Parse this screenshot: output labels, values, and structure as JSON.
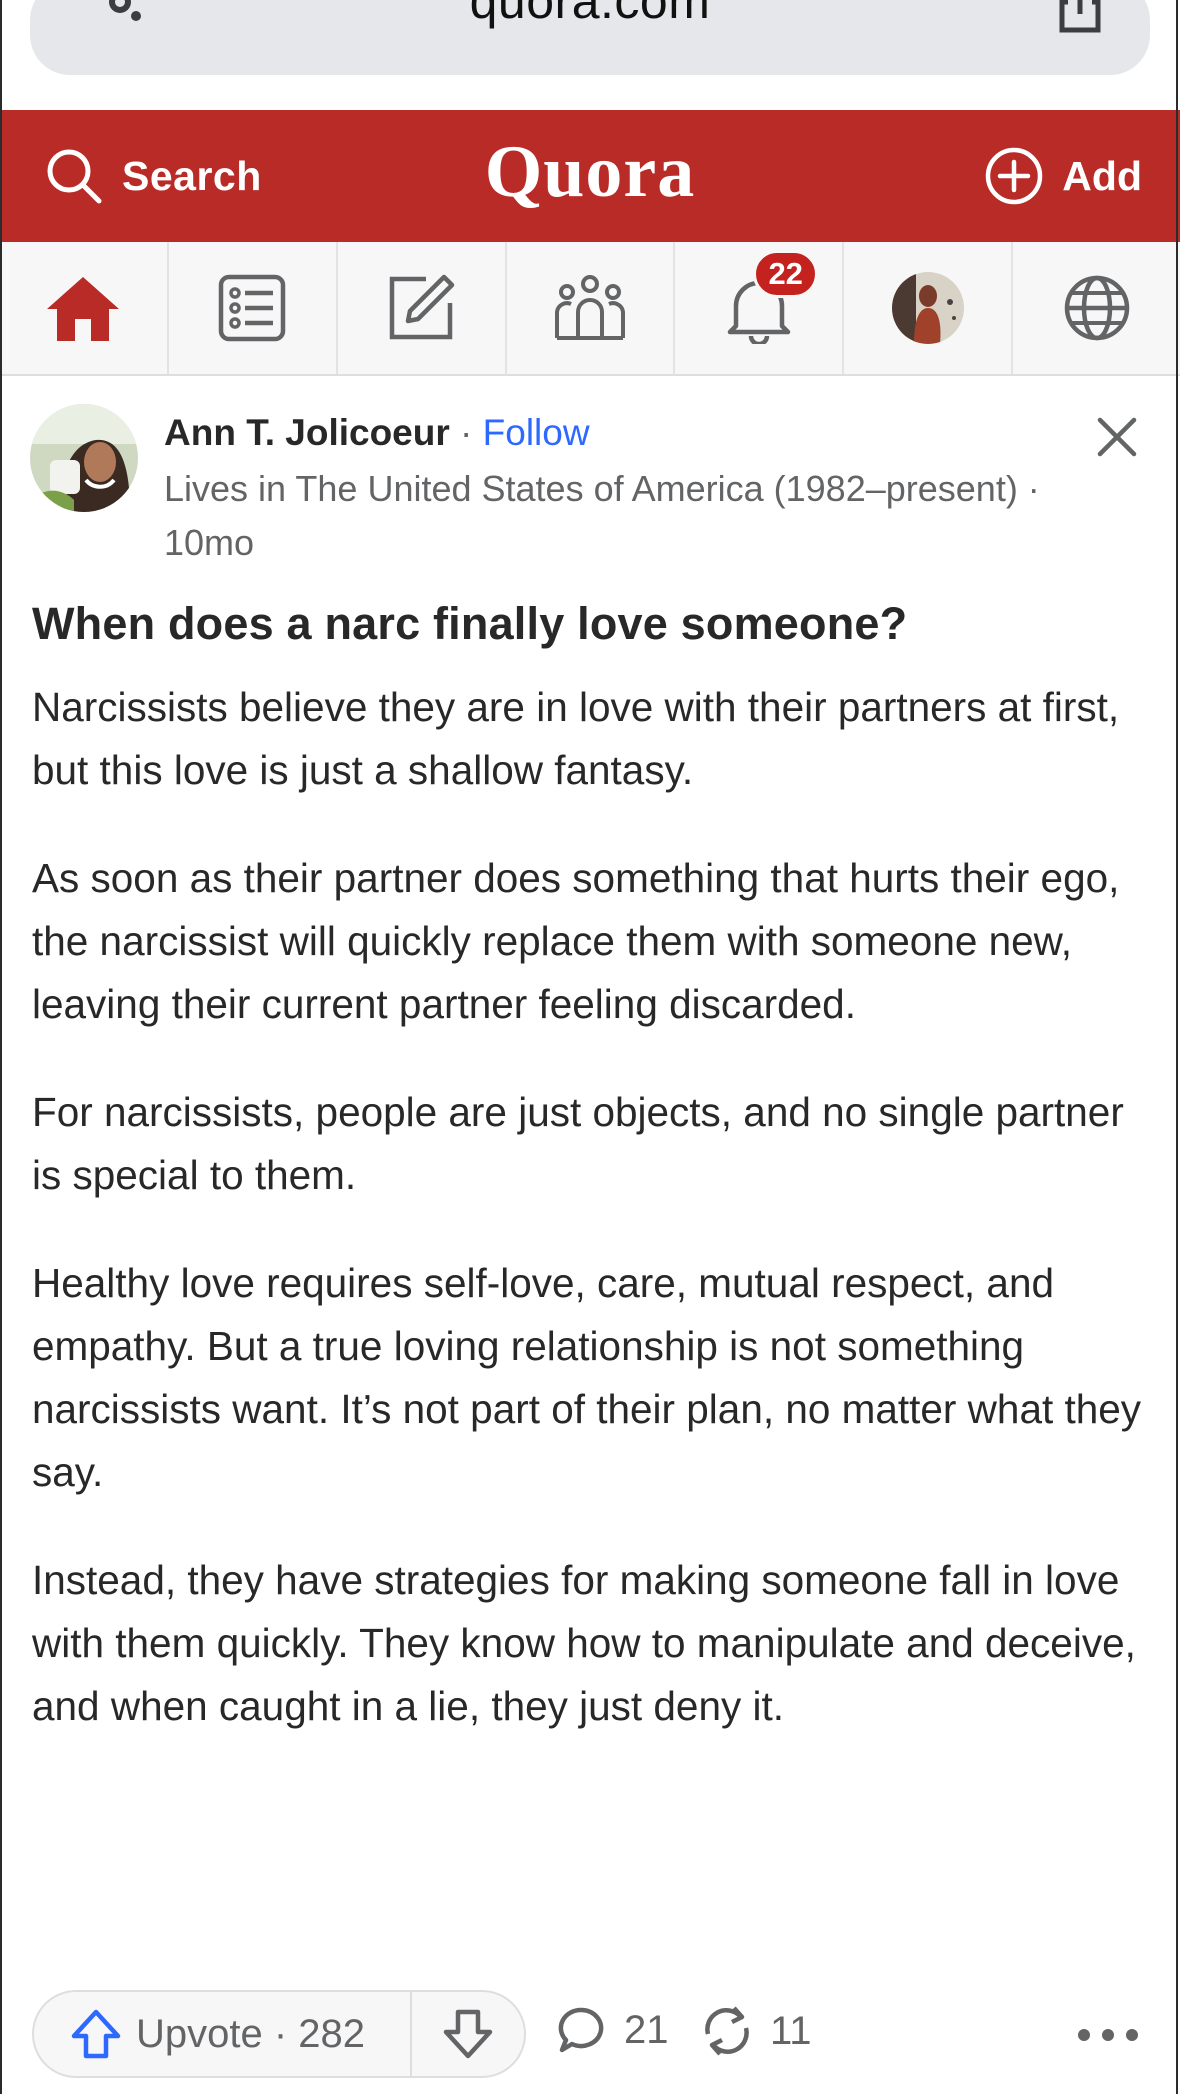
{
  "browser": {
    "url": "quora.com"
  },
  "header": {
    "search_label": "Search",
    "logo": "Quora",
    "add_label": "Add",
    "brand_color": "#b92b27"
  },
  "nav": {
    "items": [
      {
        "name": "home",
        "icon": "home-icon",
        "active": true
      },
      {
        "name": "following",
        "icon": "list-icon"
      },
      {
        "name": "answer",
        "icon": "edit-icon"
      },
      {
        "name": "spaces",
        "icon": "people-icon"
      },
      {
        "name": "notifications",
        "icon": "bell-icon",
        "badge": "22"
      },
      {
        "name": "profile",
        "icon": "avatar"
      },
      {
        "name": "languages",
        "icon": "globe-icon"
      }
    ]
  },
  "post": {
    "author": "Ann T. Jolicoeur",
    "separator": " · ",
    "follow_label": "Follow",
    "credential": "Lives in The United States of America (1982–present) · 10mo",
    "question": "When does a narc finally love someone?",
    "paragraphs": [
      "Narcissists believe they are in love with their partners at first, but this love is just a shallow fantasy.",
      "As soon as their partner does something that hurts their ego, the narcissist will quickly replace them with someone new, leaving their current partner feeling discarded.",
      "For narcissists, people are just objects, and no single partner is special to them.",
      "Healthy love requires self-love, care, mutual respect, and empathy. But a true loving relationship is not something narcissists want. It’s not part of their plan, no matter what they say.",
      "Instead, they have strategies for making someone fall in love with them quickly. They know how to manipulate and deceive, and when caught in a lie, they just deny it."
    ]
  },
  "actions": {
    "upvote_label": "Upvote · 282",
    "comments": "21",
    "shares": "11",
    "accent_color": "#2e69ff"
  }
}
